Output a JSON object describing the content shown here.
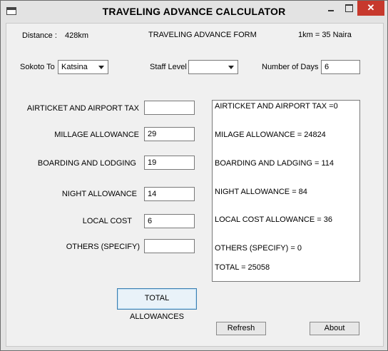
{
  "window": {
    "title": "TRAVELING ADVANCE CALCULATOR"
  },
  "header": {
    "distance_label": "Distance :",
    "distance_value": "428km",
    "form_title": "TRAVELING ADVANCE FORM",
    "rate": "1km = 35 Naira"
  },
  "selectors": {
    "destination_label": "Sokoto To",
    "destination_value": "Katsina",
    "staff_level_label": "Staff Level",
    "staff_level_value": "",
    "days_label": "Number of Days",
    "days_value": "6"
  },
  "fields": {
    "airticket_label": "AIRTICKET AND AIRPORT TAX",
    "airticket_value": "",
    "millage_label": "MILLAGE ALLOWANCE",
    "millage_value": "29",
    "boarding_label": "BOARDING AND LODGING",
    "boarding_value": "19",
    "night_label": "NIGHT ALLOWANCE",
    "night_value": "14",
    "local_label": "LOCAL COST",
    "local_value": "6",
    "others_label": "OTHERS (SPECIFY)",
    "others_value": ""
  },
  "results": {
    "airticket": "AIRTICKET AND AIRPORT TAX =0",
    "milage": "MILAGE ALLOWANCE = 24824",
    "boarding": "BOARDING AND LADGING = 114",
    "night": "NIGHT ALLOWANCE = 84",
    "local": "LOCAL COST ALLOWANCE = 36",
    "others": "OTHERS (SPECIFY) = 0",
    "total": "TOTAL = 25058"
  },
  "buttons": {
    "total": "TOTAL ALLOWANCES",
    "refresh": "Refresh",
    "about": "About",
    "close": "✕"
  }
}
